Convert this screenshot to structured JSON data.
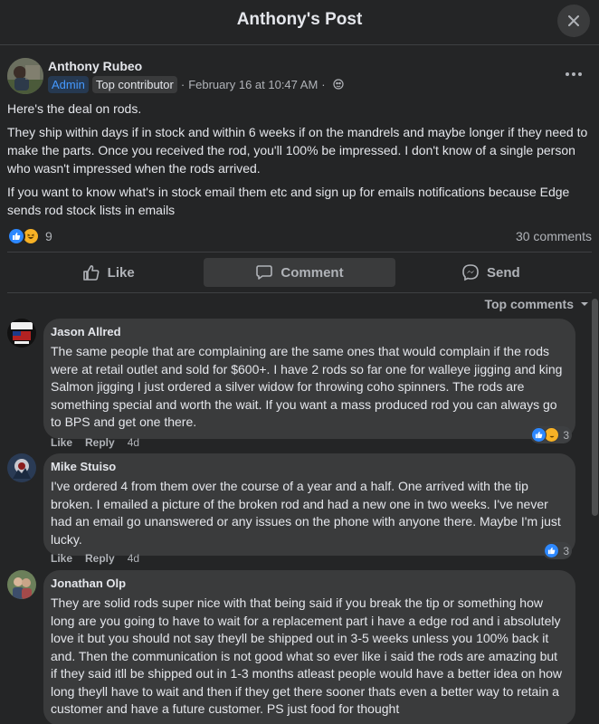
{
  "header": {
    "title": "Anthony's Post"
  },
  "post": {
    "author": "Anthony Rubeo",
    "badge_admin": "Admin",
    "badge_contributor": "Top contributor",
    "separator": "·",
    "timestamp": "February 16 at 10:47 AM",
    "paragraphs": [
      "Here's the deal on rods.",
      "They ship within days if in stock and within 6 weeks if on the mandrels and maybe longer if they need to make the parts.  Once you received the rod, you'll 100% be impressed. I don't know of a single person who wasn't impressed when the rods arrived.",
      "If you want to know what's in stock email them etc and sign up for emails notifications because Edge sends rod stock lists in emails"
    ],
    "reaction_count": "9",
    "comments_count": "30 comments"
  },
  "actions": {
    "like": "Like",
    "comment": "Comment",
    "send": "Send"
  },
  "sort": {
    "label": "Top comments"
  },
  "comments": [
    {
      "name": "Jason Allred",
      "text": "The same people that are complaining are the same ones that would complain if the rods were at retail outlet and sold for $600+. I have 2 rods so far one for walleye jigging and king Salmon jigging I just ordered a silver widow for throwing coho spinners. The rods are something special and worth the wait. If you want a mass produced rod you can always go to BPS and get one there.",
      "like": "Like",
      "reply": "Reply",
      "time": "4d",
      "reaction_count": "3"
    },
    {
      "name": "Mike Stuiso",
      "text": "I've ordered 4 from them over the course of a year and a half. One arrived with the tip broken. I emailed a picture of the broken rod and had a new one in two weeks. I've never had an email go unanswered or any issues on the phone with anyone there. Maybe I'm just lucky.",
      "like": "Like",
      "reply": "Reply",
      "time": "4d",
      "reaction_count": "3"
    },
    {
      "name": "Jonathan Olp",
      "text": "They are solid rods super nice with that being said if you break the tip or something how long are you going to have to wait for a replacement part i have a edge rod and i absolutely love it but you should not say theyll be shipped out in 3-5 weeks unless you 100% back it and. Then the communication is not good what so ever like i said the rods are amazing but if they said itll be shipped out in 1-3 months atleast people would have a better idea on how long theyll have to wait and then if they get there sooner thats even a better way to retain a customer and have a future customer. PS just food for thought"
    }
  ],
  "colors": {
    "background": "#242526",
    "bubble": "#3a3b3c",
    "admin_badge_text": "#4599ff",
    "like_blue": "#2d88ff",
    "haha_yellow": "#f7b125"
  },
  "icons": {
    "close": "close-icon",
    "more": "more-horizontal-icon",
    "globe": "globe-icon",
    "like": "thumbs-up-icon",
    "comment": "comment-bubble-icon",
    "send": "messenger-icon",
    "sort": "caret-down-icon"
  }
}
